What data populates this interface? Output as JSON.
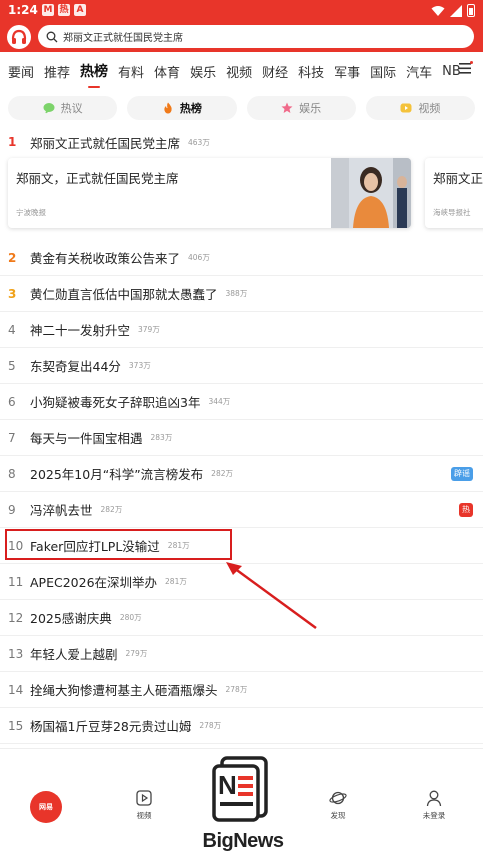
{
  "status_bar": {
    "time": "1:24",
    "notif_icons": [
      "M",
      "热",
      "A"
    ]
  },
  "header": {
    "search_text": "郑丽文正式就任国民党主席"
  },
  "channels": [
    {
      "label": "要闻"
    },
    {
      "label": "推荐"
    },
    {
      "label": "热榜",
      "active": true
    },
    {
      "label": "有料"
    },
    {
      "label": "体育"
    },
    {
      "label": "娱乐"
    },
    {
      "label": "视频"
    },
    {
      "label": "财经"
    },
    {
      "label": "科技"
    },
    {
      "label": "军事"
    },
    {
      "label": "国际"
    },
    {
      "label": "汽车"
    },
    {
      "label": "NB"
    }
  ],
  "pills": [
    {
      "label": "热议",
      "icon": "chat-bubble-icon",
      "color": "#7cd36a"
    },
    {
      "label": "热榜",
      "icon": "flame-icon",
      "color": "#f07a1a",
      "active": true
    },
    {
      "label": "娱乐",
      "icon": "star-icon",
      "color": "#f06a8a"
    },
    {
      "label": "视频",
      "icon": "play-icon",
      "color": "#f4c23a"
    }
  ],
  "top_item": {
    "rank": "1",
    "title": "郑丽文正式就任国民党主席",
    "heat": "463万"
  },
  "cards": [
    {
      "title": "郑丽文，正式就任国民党主席",
      "source": "宁波晚报"
    },
    {
      "title": "郑丽文正",
      "source": "海峡导报社"
    }
  ],
  "items": [
    {
      "rank": "2",
      "title": "黄金有关税收政策公告来了",
      "heat": "406万"
    },
    {
      "rank": "3",
      "title": "黄仁勋直言低估中国那就太愚蠢了",
      "heat": "388万"
    },
    {
      "rank": "4",
      "title": "神二十一发射升空",
      "heat": "379万"
    },
    {
      "rank": "5",
      "title": "东契奇复出44分",
      "heat": "373万"
    },
    {
      "rank": "6",
      "title": "小狗疑被毒死女子辞职追凶3年",
      "heat": "344万"
    },
    {
      "rank": "7",
      "title": "每天与一件国宝相遇",
      "heat": "283万"
    },
    {
      "rank": "8",
      "title": "2025年10月“科学”流言榜发布",
      "heat": "282万",
      "tag": "辟谣"
    },
    {
      "rank": "9",
      "title": "冯淬帆去世",
      "heat": "282万",
      "tag": "热"
    },
    {
      "rank": "10",
      "title": "Faker回应打LPL没输过",
      "heat": "281万"
    },
    {
      "rank": "11",
      "title": "APEC2026在深圳举办",
      "heat": "281万"
    },
    {
      "rank": "12",
      "title": "2025感谢庆典",
      "heat": "280万"
    },
    {
      "rank": "13",
      "title": "年轻人爱上越剧",
      "heat": "279万"
    },
    {
      "rank": "14",
      "title": "拴绳大狗惨遭柯基主人砸酒瓶爆头",
      "heat": "278万"
    },
    {
      "rank": "15",
      "title": "杨国福1斤豆芽28元贵过山姆",
      "heat": "278万"
    }
  ],
  "bottom_nav": [
    {
      "label": "",
      "icon": "home-icon"
    },
    {
      "label": "视频",
      "icon": "video-icon"
    },
    {
      "label": "发现",
      "icon": "planet-icon"
    },
    {
      "label": "未登录",
      "icon": "user-icon"
    }
  ],
  "home_badge": "网易",
  "watermark": {
    "text": "BigNews"
  },
  "colors": {
    "brand_red": "#e8352a",
    "annotation_red": "#d81e1e"
  }
}
